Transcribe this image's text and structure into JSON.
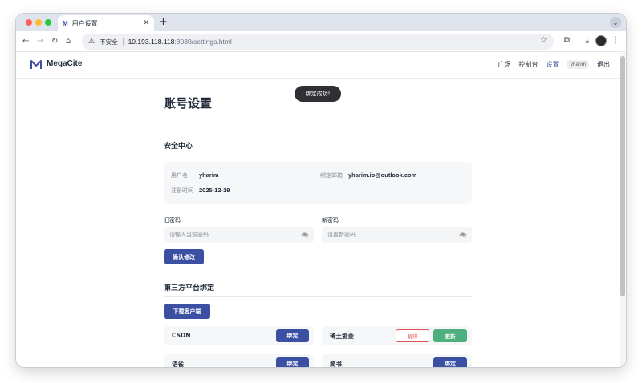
{
  "browser": {
    "tab_title": "用户设置",
    "tab_favicon": "M",
    "new_tab": "+",
    "insecure_label": "不安全",
    "url_host": "10.193.118.118",
    "url_path": ":8080/settings.html"
  },
  "site": {
    "brand": "MegaCite",
    "nav": {
      "plaza": "广场",
      "dashboard": "控制台",
      "settings": "设置",
      "user": "yharim",
      "logout": "退出"
    }
  },
  "toast": "绑定成功!",
  "page": {
    "title": "账号设置",
    "security": {
      "title": "安全中心",
      "username_label": "用户名",
      "username": "yharim",
      "email_label": "绑定邮箱",
      "email": "yharim.io@outlook.com",
      "registered_label": "注册时间",
      "registered": "2025-12-19",
      "old_password_label": "旧密码",
      "old_password_placeholder": "请输入当前密码",
      "new_password_label": "新密码",
      "new_password_placeholder": "设置新密码",
      "confirm_button": "确认修改"
    },
    "thirdparty": {
      "title": "第三方平台绑定",
      "download_button": "下载客户端",
      "platforms": [
        {
          "name": "CSDN",
          "bind": "绑定"
        },
        {
          "name": "稀土掘金",
          "unbind": "解绑",
          "update": "更新"
        },
        {
          "name": "语雀",
          "bind": "绑定"
        },
        {
          "name": "简书",
          "bind": "绑定"
        }
      ]
    }
  },
  "colors": {
    "accent": "#3b4fa3",
    "danger": "#e05252",
    "success": "#4caf7d"
  }
}
